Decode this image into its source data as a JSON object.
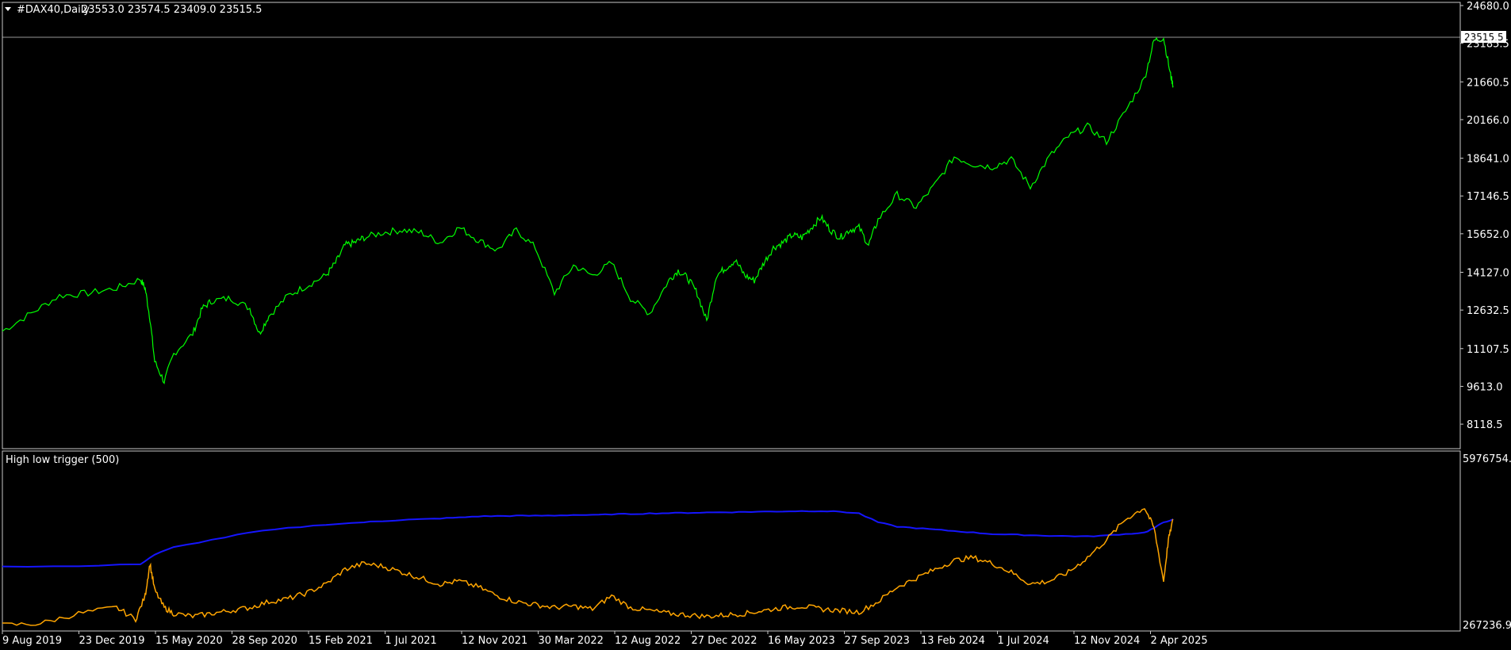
{
  "header": {
    "symbol_label": "#DAX40,Daily",
    "ohlc": "23553.0 23574.5 23409.0 23515.5"
  },
  "price_marker": "23515.5",
  "indicator": {
    "label": "High low trigger (500)",
    "y_top_label": "5976754.3",
    "y_bottom_label": "267236.9"
  },
  "colors": {
    "price": "#00ff00",
    "indicator_blue": "#1515ff",
    "indicator_orange": "#ffa500",
    "frame": "#c8c8c8"
  },
  "chart_data": [
    {
      "type": "line",
      "name": "price",
      "ylim": [
        7400,
        24680
      ],
      "y_ticks": [
        "24680.0",
        "23185.5",
        "21660.5",
        "20166.0",
        "18641.0",
        "17146.5",
        "15652.0",
        "14127.0",
        "12632.5",
        "11107.5",
        "9613.0",
        "8118.5"
      ],
      "x_ticks": [
        "9 Aug 2019",
        "23 Dec 2019",
        "15 May 2020",
        "28 Sep 2020",
        "15 Feb 2021",
        "1 Jul 2021",
        "12 Nov 2021",
        "30 Mar 2022",
        "12 Aug 2022",
        "27 Dec 2022",
        "16 May 2023",
        "27 Sep 2023",
        "13 Feb 2024",
        "1 Jul 2024",
        "12 Nov 2024",
        "2 Apr 2025"
      ],
      "x": [
        0,
        3,
        6,
        9,
        12,
        14.5,
        15,
        15.5,
        16,
        17,
        18,
        20,
        21,
        22,
        24,
        26,
        27,
        28,
        30,
        32,
        34,
        35,
        36,
        37,
        38,
        40,
        42,
        44,
        46,
        48,
        50,
        52,
        54,
        56,
        58,
        60,
        62,
        64,
        66,
        68,
        70,
        71,
        72,
        73,
        74,
        75,
        76,
        77,
        78,
        79,
        80,
        81,
        82,
        83,
        84,
        85,
        86,
        87,
        88,
        89,
        90,
        91,
        92,
        94,
        96,
        98,
        100,
        102,
        104,
        106,
        108,
        110,
        112,
        114,
        116,
        118,
        120,
        121,
        122,
        122.7,
        123
      ],
      "values": [
        11800,
        12500,
        13200,
        13300,
        13500,
        13850,
        13500,
        12300,
        10600,
        9800,
        10900,
        11700,
        12700,
        13000,
        13100,
        12700,
        11700,
        12400,
        13200,
        13600,
        14000,
        14500,
        15200,
        15300,
        15500,
        15700,
        15800,
        15700,
        15300,
        15900,
        15400,
        15000,
        15800,
        15100,
        13300,
        14400,
        14000,
        14500,
        13100,
        12500,
        13800,
        14200,
        13900,
        13300,
        12200,
        14000,
        14300,
        14600,
        14000,
        13800,
        14500,
        15100,
        15300,
        15600,
        15500,
        15900,
        16300,
        15800,
        15500,
        15800,
        15900,
        15200,
        16200,
        17200,
        16700,
        17600,
        18700,
        18400,
        18300,
        18600,
        17500,
        18700,
        19500,
        19900,
        19300,
        20500,
        21800,
        23300,
        23400,
        22000,
        21500
      ]
    },
    {
      "type": "line",
      "name": "High low trigger (500)",
      "ylim": [
        267236.9,
        5976754.3
      ],
      "series": [
        {
          "name": "blue",
          "x": [
            0,
            8,
            14.5,
            16,
            18,
            22,
            26,
            30,
            34,
            38,
            40,
            42,
            44,
            46,
            48,
            50,
            52,
            54,
            56,
            58,
            60,
            62,
            64,
            66,
            68,
            70,
            72,
            74,
            76,
            78,
            80,
            82,
            84,
            86,
            88,
            90,
            92,
            94,
            96,
            98,
            100,
            102,
            104,
            106,
            108,
            110,
            112,
            114,
            116,
            118,
            120,
            121,
            122,
            123
          ],
          "values": [
            2300000,
            2300000,
            2380000,
            2700000,
            2950000,
            3200000,
            3450000,
            3600000,
            3720000,
            3800000,
            3840000,
            3880000,
            3900000,
            3930000,
            3960000,
            4000000,
            4010000,
            4020000,
            4020000,
            4030000,
            4050000,
            4040000,
            4070000,
            4080000,
            4100000,
            4110000,
            4120000,
            4130000,
            4140000,
            4150000,
            4160000,
            4170000,
            4180000,
            4180000,
            4160000,
            4100000,
            3800000,
            3650000,
            3600000,
            3550000,
            3500000,
            3450000,
            3400000,
            3380000,
            3360000,
            3340000,
            3330000,
            3320000,
            3350000,
            3400000,
            3450000,
            3600000,
            3800000,
            3900000
          ]
        },
        {
          "name": "orange",
          "x": [
            0,
            4,
            8,
            12,
            14,
            15,
            15.5,
            16,
            17,
            18,
            20,
            22,
            24,
            26,
            28,
            30,
            32,
            34,
            36,
            38,
            40,
            42,
            44,
            46,
            48,
            50,
            52,
            54,
            56,
            58,
            60,
            62,
            64,
            66,
            68,
            70,
            72,
            74,
            76,
            78,
            80,
            82,
            84,
            86,
            88,
            90,
            92,
            94,
            96,
            98,
            100,
            102,
            104,
            106,
            108,
            110,
            112,
            114,
            116,
            118,
            120,
            121,
            122,
            122.5,
            123
          ],
          "values": [
            300000,
            360000,
            700000,
            900000,
            500000,
            1300000,
            2400000,
            1500000,
            900000,
            700000,
            600000,
            700000,
            800000,
            900000,
            1100000,
            1200000,
            1400000,
            1700000,
            2200000,
            2400000,
            2300000,
            2100000,
            1900000,
            1700000,
            1800000,
            1600000,
            1300000,
            1100000,
            1000000,
            900000,
            950000,
            850000,
            1300000,
            900000,
            800000,
            700000,
            650000,
            600000,
            650000,
            700000,
            800000,
            900000,
            950000,
            850000,
            800000,
            750000,
            1100000,
            1600000,
            1900000,
            2200000,
            2500000,
            2600000,
            2400000,
            2100000,
            1700000,
            1800000,
            2100000,
            2600000,
            3200000,
            3900000,
            4300000,
            3600000,
            1800000,
            3200000,
            3900000
          ]
        }
      ]
    }
  ]
}
